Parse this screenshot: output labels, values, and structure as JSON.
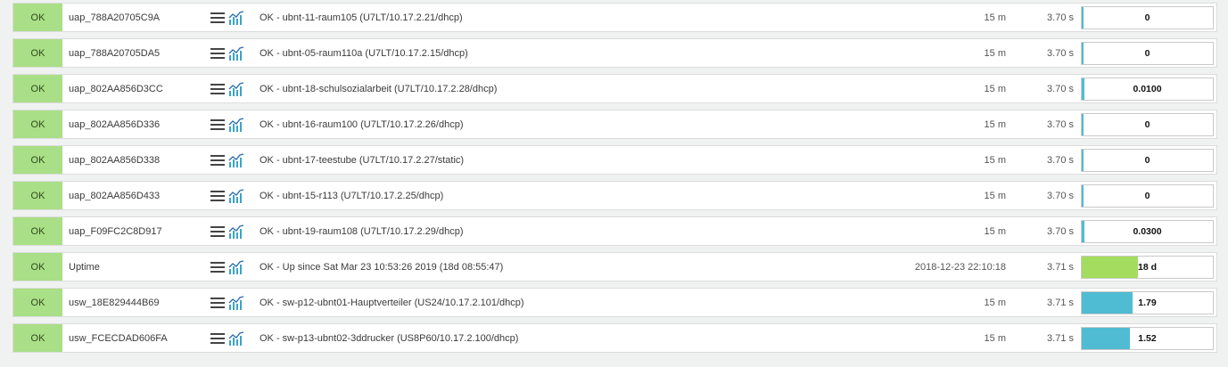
{
  "rows": [
    {
      "state": "OK",
      "service": "uap_788A20705C9A",
      "summary": "OK - ubnt-11-raum105 (U7LT/10.17.2.21/dhcp)",
      "age": "15 m",
      "checktime": "3.70 s",
      "perf": {
        "label": "0",
        "fraction": 0.0,
        "color": "#4fbcd3"
      }
    },
    {
      "state": "OK",
      "service": "uap_788A20705DA5",
      "summary": "OK - ubnt-05-raum110a (U7LT/10.17.2.15/dhcp)",
      "age": "15 m",
      "checktime": "3.70 s",
      "perf": {
        "label": "0",
        "fraction": 0.0,
        "color": "#4fbcd3"
      }
    },
    {
      "state": "OK",
      "service": "uap_802AA856D3CC",
      "summary": "OK - ubnt-18-schulsozialarbeit (U7LT/10.17.2.28/dhcp)",
      "age": "15 m",
      "checktime": "3.70 s",
      "perf": {
        "label": "0.0100",
        "fraction": 0.02,
        "color": "#4fbcd3"
      }
    },
    {
      "state": "OK",
      "service": "uap_802AA856D336",
      "summary": "OK - ubnt-16-raum100 (U7LT/10.17.2.26/dhcp)",
      "age": "15 m",
      "checktime": "3.70 s",
      "perf": {
        "label": "0",
        "fraction": 0.0,
        "color": "#4fbcd3"
      }
    },
    {
      "state": "OK",
      "service": "uap_802AA856D338",
      "summary": "OK - ubnt-17-teestube (U7LT/10.17.2.27/static)",
      "age": "15 m",
      "checktime": "3.70 s",
      "perf": {
        "label": "0",
        "fraction": 0.0,
        "color": "#4fbcd3"
      }
    },
    {
      "state": "OK",
      "service": "uap_802AA856D433",
      "summary": "OK - ubnt-15-r113 (U7LT/10.17.2.25/dhcp)",
      "age": "15 m",
      "checktime": "3.70 s",
      "perf": {
        "label": "0",
        "fraction": 0.0,
        "color": "#4fbcd3"
      }
    },
    {
      "state": "OK",
      "service": "uap_F09FC2C8D917",
      "summary": "OK - ubnt-19-raum108 (U7LT/10.17.2.29/dhcp)",
      "age": "15 m",
      "checktime": "3.70 s",
      "perf": {
        "label": "0.0300",
        "fraction": 0.02,
        "color": "#4fbcd3"
      }
    },
    {
      "state": "OK",
      "service": "Uptime",
      "summary": "OK - Up since Sat Mar 23 10:53:26 2019 (18d 08:55:47)",
      "age": "2018-12-23 22:10:18",
      "checktime": "3.71 s",
      "perf": {
        "label": "18 d",
        "fraction": 0.43,
        "color": "#a4dc5f"
      }
    },
    {
      "state": "OK",
      "service": "usw_18E829444B69",
      "summary": "OK - sw-p12-ubnt01-Hauptverteiler (US24/10.17.2.101/dhcp)",
      "age": "15 m",
      "checktime": "3.71 s",
      "perf": {
        "label": "1.79",
        "fraction": 0.39,
        "color": "#4fbcd3"
      }
    },
    {
      "state": "OK",
      "service": "usw_FCECDAD606FA",
      "summary": "OK - sw-p13-ubnt02-3ddrucker (US8P60/10.17.2.100/dhcp)",
      "age": "15 m",
      "checktime": "3.71 s",
      "perf": {
        "label": "1.52",
        "fraction": 0.37,
        "color": "#4fbcd3"
      }
    }
  ],
  "icons": {
    "menu": "hamburger-menu-icon",
    "graph": "graph-icon"
  },
  "colors": {
    "state_ok": "#a9df86",
    "perf_blue": "#4fbcd3",
    "perf_green": "#a4dc5f"
  }
}
